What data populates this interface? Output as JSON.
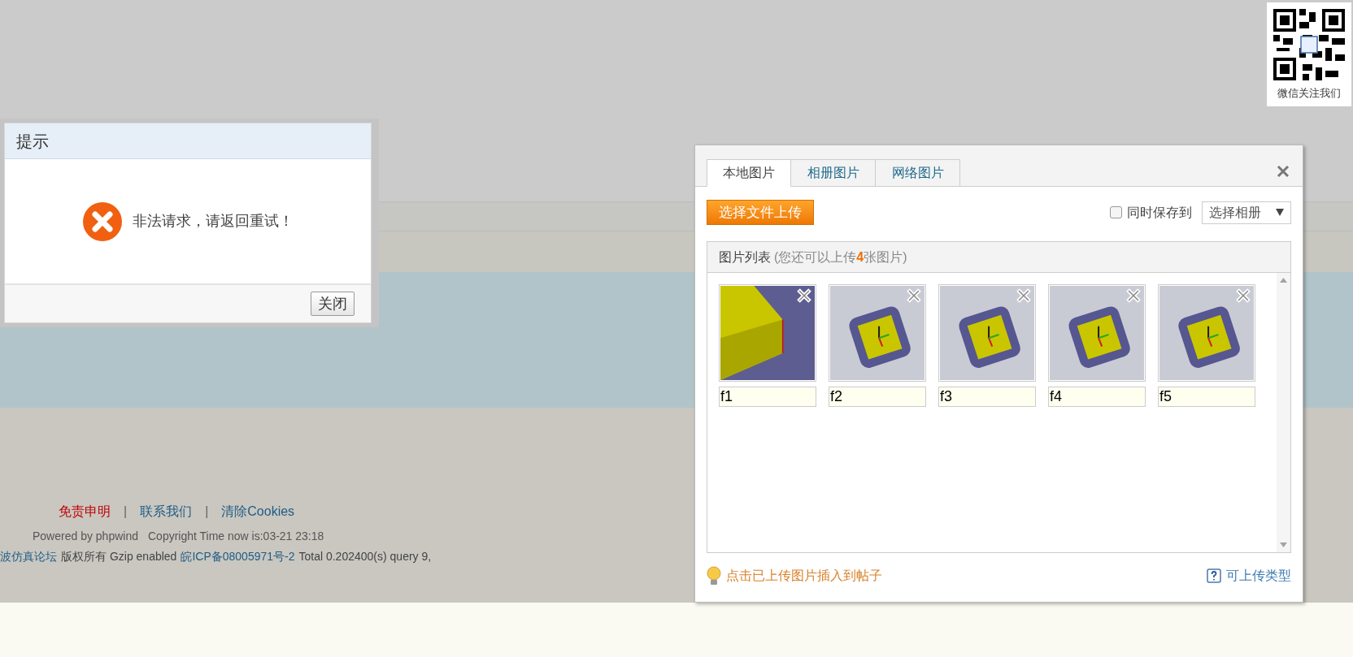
{
  "qr": {
    "caption": "微信关注我们"
  },
  "alert": {
    "title": "提示",
    "message": "非法请求，请返回重试！",
    "button": "关闭"
  },
  "footer": {
    "links": [
      {
        "label": "免责申明",
        "kind": "notice"
      },
      {
        "label": "|",
        "kind": "separator"
      },
      {
        "label": "联系我们",
        "kind": "link"
      },
      {
        "label": "|",
        "kind": "separator"
      },
      {
        "label": "清除Cookies",
        "kind": "link"
      }
    ],
    "powered": "Powered by phpwind",
    "copyright": "Copyright Time now is:03-21 23:18",
    "info": [
      {
        "text": "波仿真论坛",
        "kind": "link"
      },
      {
        "text": "版权所有 Gzip enabled",
        "kind": "text"
      },
      {
        "text": "皖ICP备08005971号-2",
        "kind": "link"
      },
      {
        "text": "Total 0.202400(s) query 9,",
        "kind": "text"
      }
    ]
  },
  "upload": {
    "tabs": [
      {
        "label": "本地图片",
        "selected": true
      },
      {
        "label": "相册图片",
        "selected": false
      },
      {
        "label": "网络图片",
        "selected": false
      }
    ],
    "upload_button": "选择文件上传",
    "save_option": {
      "label": "同时保存到",
      "checked": false
    },
    "album_select": {
      "value": "选择相册"
    },
    "list": {
      "title": "图片列表",
      "note": "(您还可以上传**4**张图片)",
      "images": [
        {
          "caption": "f1"
        },
        {
          "caption": "f2"
        },
        {
          "caption": "f3"
        },
        {
          "caption": "f4"
        },
        {
          "caption": "f5"
        }
      ]
    },
    "hint": "点击已上传图片插入到帖子",
    "help_link": "可上传类型"
  }
}
